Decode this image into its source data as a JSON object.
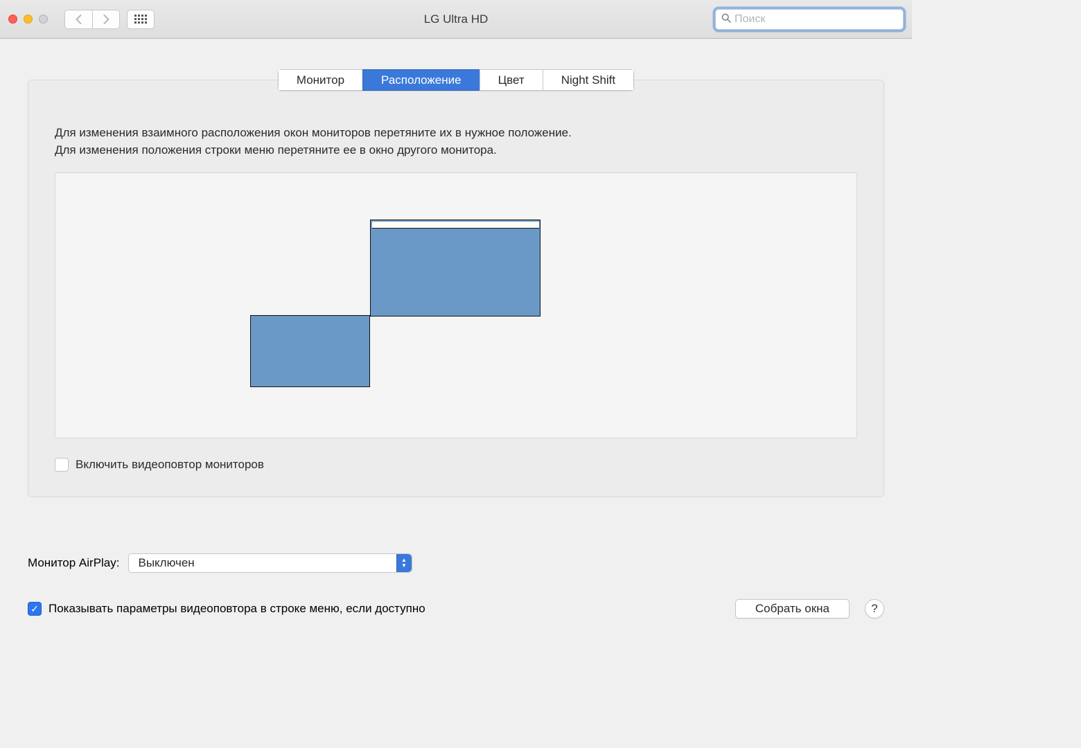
{
  "titlebar": {
    "title": "LG Ultra HD",
    "search_placeholder": "Поиск"
  },
  "tabs": {
    "monitor": "Монитор",
    "arrangement": "Расположение",
    "color": "Цвет",
    "night_shift": "Night Shift"
  },
  "panel": {
    "instruction_line1": "Для изменения взаимного расположения окон мониторов перетяните их в нужное положение.",
    "instruction_line2": "Для изменения положения строки меню перетяните ее в окно другого монитора.",
    "mirror_checkbox_label": "Включить видеоповтор мониторов",
    "mirror_checked": false
  },
  "footer": {
    "airplay_label": "Монитор AirPlay:",
    "airplay_value": "Выключен",
    "show_mirror_checkbox_label": "Показывать параметры видеоповтора в строке меню, если доступно",
    "show_mirror_checked": true,
    "gather_windows_label": "Собрать окна",
    "help_label": "?"
  }
}
